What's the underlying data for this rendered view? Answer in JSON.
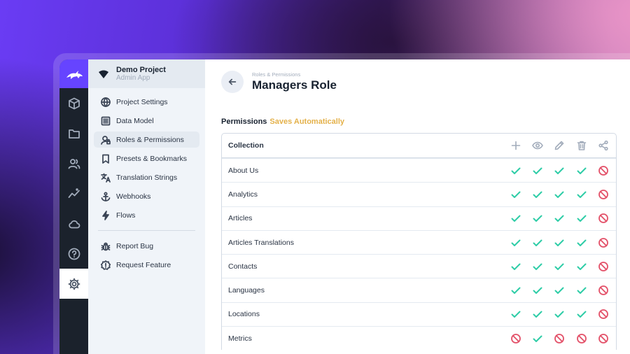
{
  "sidebar_modules": [
    {
      "icon": "cube-icon"
    },
    {
      "icon": "folder-icon"
    },
    {
      "icon": "users-icon"
    },
    {
      "icon": "insights-icon"
    },
    {
      "icon": "cloud-icon"
    },
    {
      "icon": "help-icon"
    },
    {
      "icon": "gear-icon",
      "active": true
    }
  ],
  "project": {
    "name": "Demo Project",
    "subtitle": "Admin App"
  },
  "nav": {
    "items": [
      {
        "label": "Project Settings",
        "icon": "globe-icon"
      },
      {
        "label": "Data Model",
        "icon": "list-box-icon"
      },
      {
        "label": "Roles & Permissions",
        "icon": "user-lock-icon",
        "active": true
      },
      {
        "label": "Presets & Bookmarks",
        "icon": "bookmark-icon"
      },
      {
        "label": "Translation Strings",
        "icon": "translate-icon"
      },
      {
        "label": "Webhooks",
        "icon": "anchor-icon"
      },
      {
        "label": "Flows",
        "icon": "bolt-icon"
      }
    ],
    "footer_items": [
      {
        "label": "Report Bug",
        "icon": "bug-icon"
      },
      {
        "label": "Request Feature",
        "icon": "new-release-icon"
      }
    ]
  },
  "header": {
    "breadcrumb": "Roles & Permissions",
    "title": "Managers Role"
  },
  "permissions": {
    "label": "Permissions",
    "status": "Saves Automatically",
    "column_header": "Collection",
    "action_icons": [
      "add-icon",
      "eye-icon",
      "edit-icon",
      "trash-icon",
      "share-icon"
    ],
    "rows": [
      {
        "name": "About Us",
        "perms": [
          "yes",
          "yes",
          "yes",
          "yes",
          "no"
        ]
      },
      {
        "name": "Analytics",
        "perms": [
          "yes",
          "yes",
          "yes",
          "yes",
          "no"
        ]
      },
      {
        "name": "Articles",
        "perms": [
          "yes",
          "yes",
          "yes",
          "yes",
          "no"
        ]
      },
      {
        "name": "Articles Translations",
        "perms": [
          "yes",
          "yes",
          "yes",
          "yes",
          "no"
        ]
      },
      {
        "name": "Contacts",
        "perms": [
          "yes",
          "yes",
          "yes",
          "yes",
          "no"
        ]
      },
      {
        "name": "Languages",
        "perms": [
          "yes",
          "yes",
          "yes",
          "yes",
          "no"
        ]
      },
      {
        "name": "Locations",
        "perms": [
          "yes",
          "yes",
          "yes",
          "yes",
          "no"
        ]
      },
      {
        "name": "Metrics",
        "perms": [
          "no",
          "yes",
          "no",
          "no",
          "no"
        ]
      }
    ]
  },
  "colors": {
    "accent": "#6644ff",
    "allowed": "#2ecda7",
    "denied": "#e35169",
    "status": "#e4b14a"
  }
}
